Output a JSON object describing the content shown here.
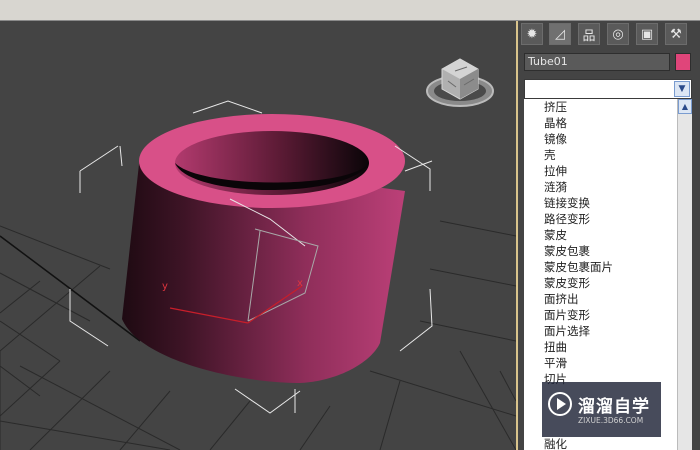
{
  "command_panel": {
    "tabs": [
      {
        "icon": "create-icon"
      },
      {
        "icon": "modify-icon"
      },
      {
        "icon": "hierarchy-icon"
      },
      {
        "icon": "motion-icon"
      },
      {
        "icon": "display-icon"
      },
      {
        "icon": "utilities-icon"
      }
    ],
    "object_name": "Tube01",
    "object_color": "#e0457a",
    "modifier_list_selected": "",
    "modifier_list": [
      "挤压",
      "晶格",
      "镜像",
      "壳",
      "拉伸",
      "涟漪",
      "链接变换",
      "路径变形",
      "蒙皮",
      "蒙皮包裹",
      "蒙皮包裹面片",
      "蒙皮变形",
      "面挤出",
      "面片变形",
      "面片选择",
      "扭曲",
      "平滑",
      "切片"
    ],
    "modifier_list_partial": "融化"
  },
  "viewport": {
    "axis_labels": {
      "x": "x",
      "y": "y"
    },
    "viewcube_icon": "viewcube-icon"
  },
  "watermark": {
    "title": "溜溜自学",
    "url": "ZIXUE.3D66.COM"
  }
}
